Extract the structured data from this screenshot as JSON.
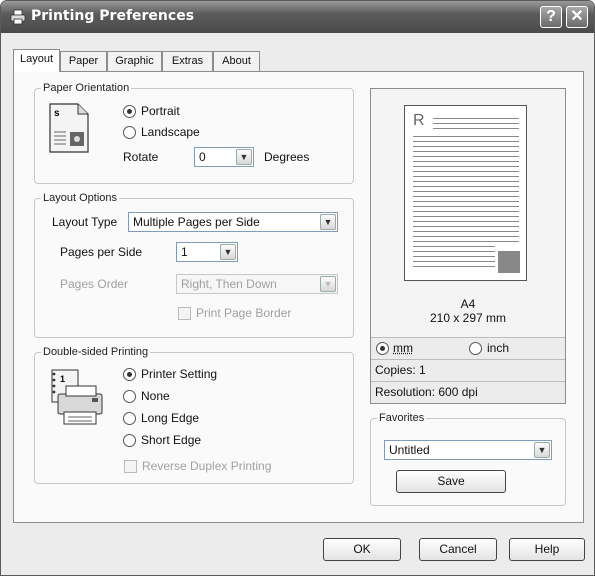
{
  "window": {
    "title": "Printing Preferences",
    "help_glyph": "?",
    "close_glyph": "✕"
  },
  "tabs": [
    {
      "label": "Layout"
    },
    {
      "label": "Paper"
    },
    {
      "label": "Graphic"
    },
    {
      "label": "Extras"
    },
    {
      "label": "About"
    }
  ],
  "paper_orientation": {
    "legend": "Paper Orientation",
    "portrait": "Portrait",
    "landscape": "Landscape",
    "selected": "Portrait",
    "rotate_label": "Rotate",
    "rotate_value": "0",
    "degrees_label": "Degrees"
  },
  "layout_options": {
    "legend": "Layout Options",
    "layout_type_label": "Layout Type",
    "layout_type_value": "Multiple Pages per Side",
    "pages_per_side_label": "Pages per Side",
    "pages_per_side_value": "1",
    "pages_order_label": "Pages Order",
    "pages_order_value": "Right, Then Down",
    "print_page_border": "Print Page Border"
  },
  "double_sided": {
    "legend": "Double-sided Printing",
    "printer_setting": "Printer Setting",
    "none": "None",
    "long_edge": "Long Edge",
    "short_edge": "Short Edge",
    "selected": "Printer Setting",
    "reverse_duplex": "Reverse Duplex Printing"
  },
  "preview": {
    "page_letter": "R",
    "paper_name": "A4",
    "paper_size": "210 x 297 mm",
    "unit_mm": "mm",
    "unit_inch": "inch",
    "unit_selected": "mm",
    "copies": "Copies: 1",
    "resolution": "Resolution: 600 dpi"
  },
  "favorites": {
    "legend": "Favorites",
    "value": "Untitled",
    "save_label": "Save"
  },
  "buttons": {
    "ok": "OK",
    "cancel": "Cancel",
    "help": "Help"
  },
  "colors": {
    "accent_gray": "#9a9a9a",
    "titlebar": "#5c5c5c"
  }
}
